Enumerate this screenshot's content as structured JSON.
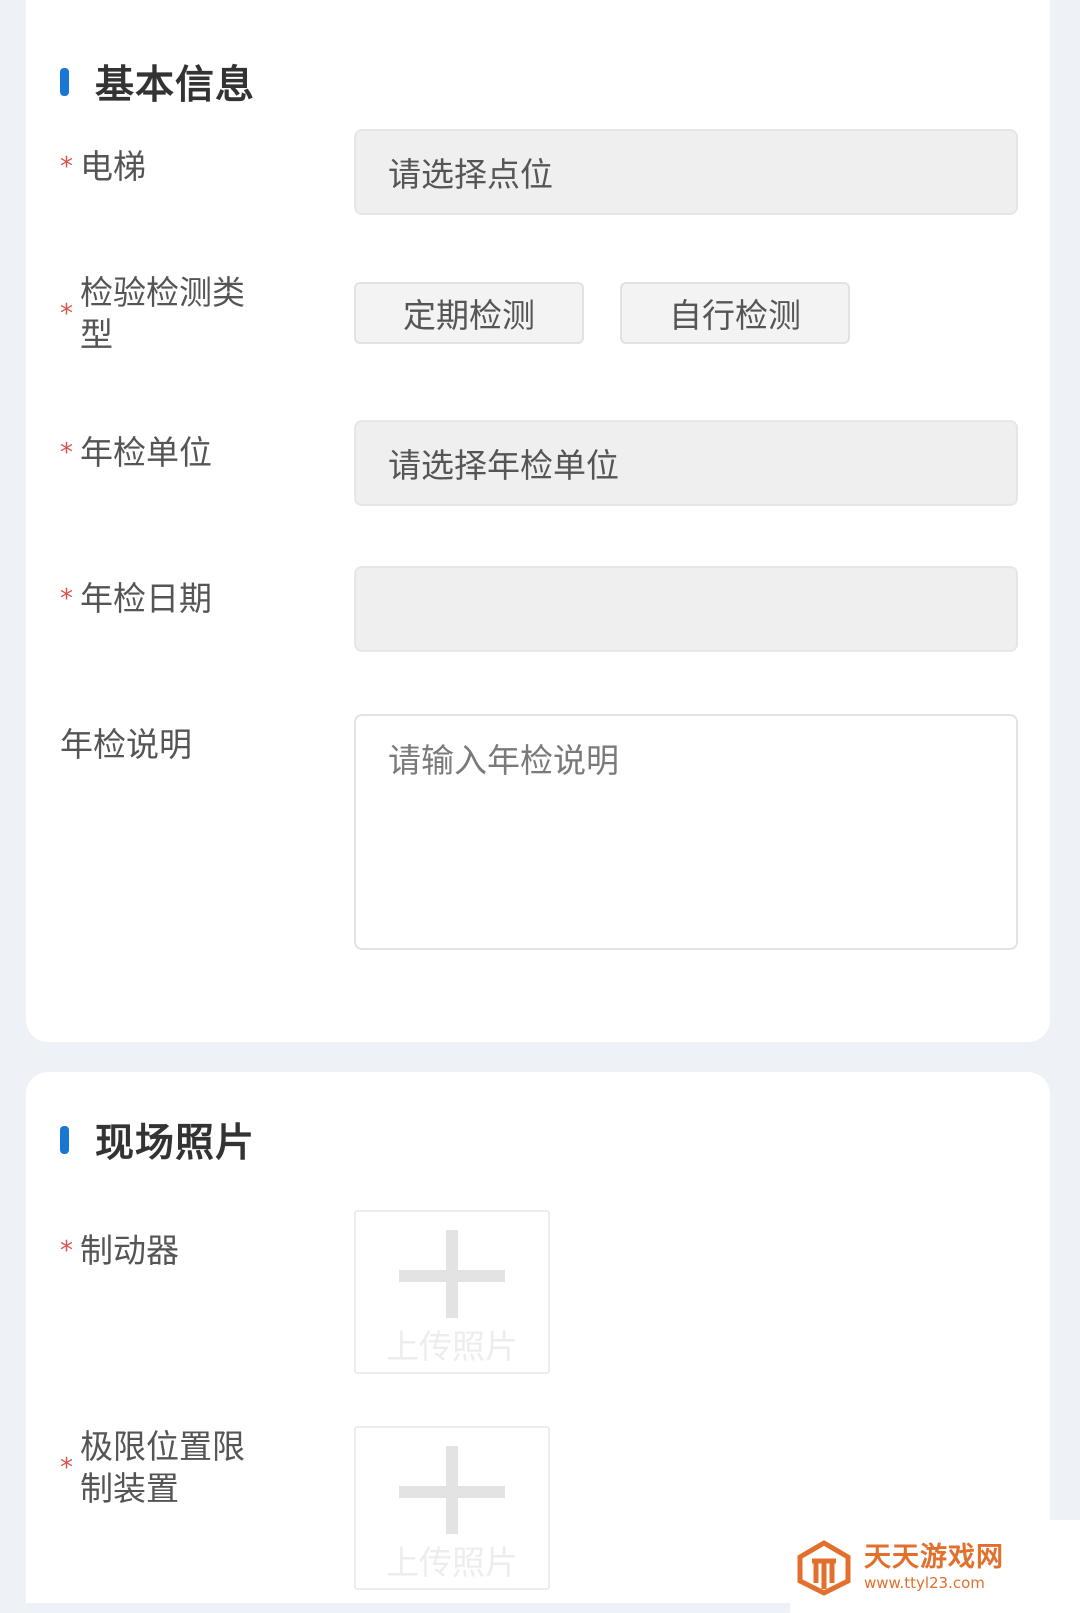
{
  "basic_info": {
    "title": "基本信息",
    "fields": {
      "elevator": {
        "label": "电梯",
        "required": "*",
        "placeholder": "请选择点位"
      },
      "inspection_type": {
        "label_line1": "检验检测类",
        "label_line2": "型",
        "required": "*",
        "options": [
          "定期检测",
          "自行检测"
        ]
      },
      "inspection_unit": {
        "label": "年检单位",
        "required": "*",
        "placeholder": "请选择年检单位"
      },
      "inspection_date": {
        "label": "年检日期",
        "required": "*",
        "value": ""
      },
      "inspection_note": {
        "label": "年检说明",
        "placeholder": "请输入年检说明"
      }
    }
  },
  "site_photos": {
    "title": "现场照片",
    "items": [
      {
        "label_line1": "制动器",
        "label_line2": "",
        "required": "*",
        "upload_label": "上传照片"
      },
      {
        "label_line1": "极限位置限",
        "label_line2": "制装置",
        "required": "*",
        "upload_label": "上传照片"
      }
    ]
  },
  "watermark": {
    "name": "天天游戏网",
    "url": "www.ttyl23.com"
  },
  "colors": {
    "accent": "#1976d2",
    "required": "#d9534f",
    "watermark": "#e36f2c"
  }
}
